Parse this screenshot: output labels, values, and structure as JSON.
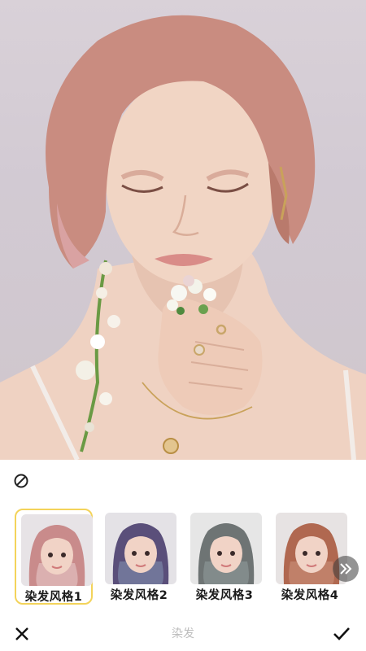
{
  "editor": {
    "title": "染发",
    "reset_icon": "no-effect-icon",
    "close_icon": "close-icon",
    "confirm_icon": "checkmark-icon",
    "more_icon": "double-chevron-right-icon",
    "accent_color": "#f3d35a"
  },
  "styles": [
    {
      "label": "染发风格1",
      "hair_color": "#c98b8b",
      "selected": true
    },
    {
      "label": "染发风格2",
      "hair_color": "#5a4f7a",
      "selected": false
    },
    {
      "label": "染发风格3",
      "hair_color": "#6e7474",
      "selected": false
    },
    {
      "label": "染发风格4",
      "hair_color": "#b06850",
      "selected": false
    }
  ]
}
